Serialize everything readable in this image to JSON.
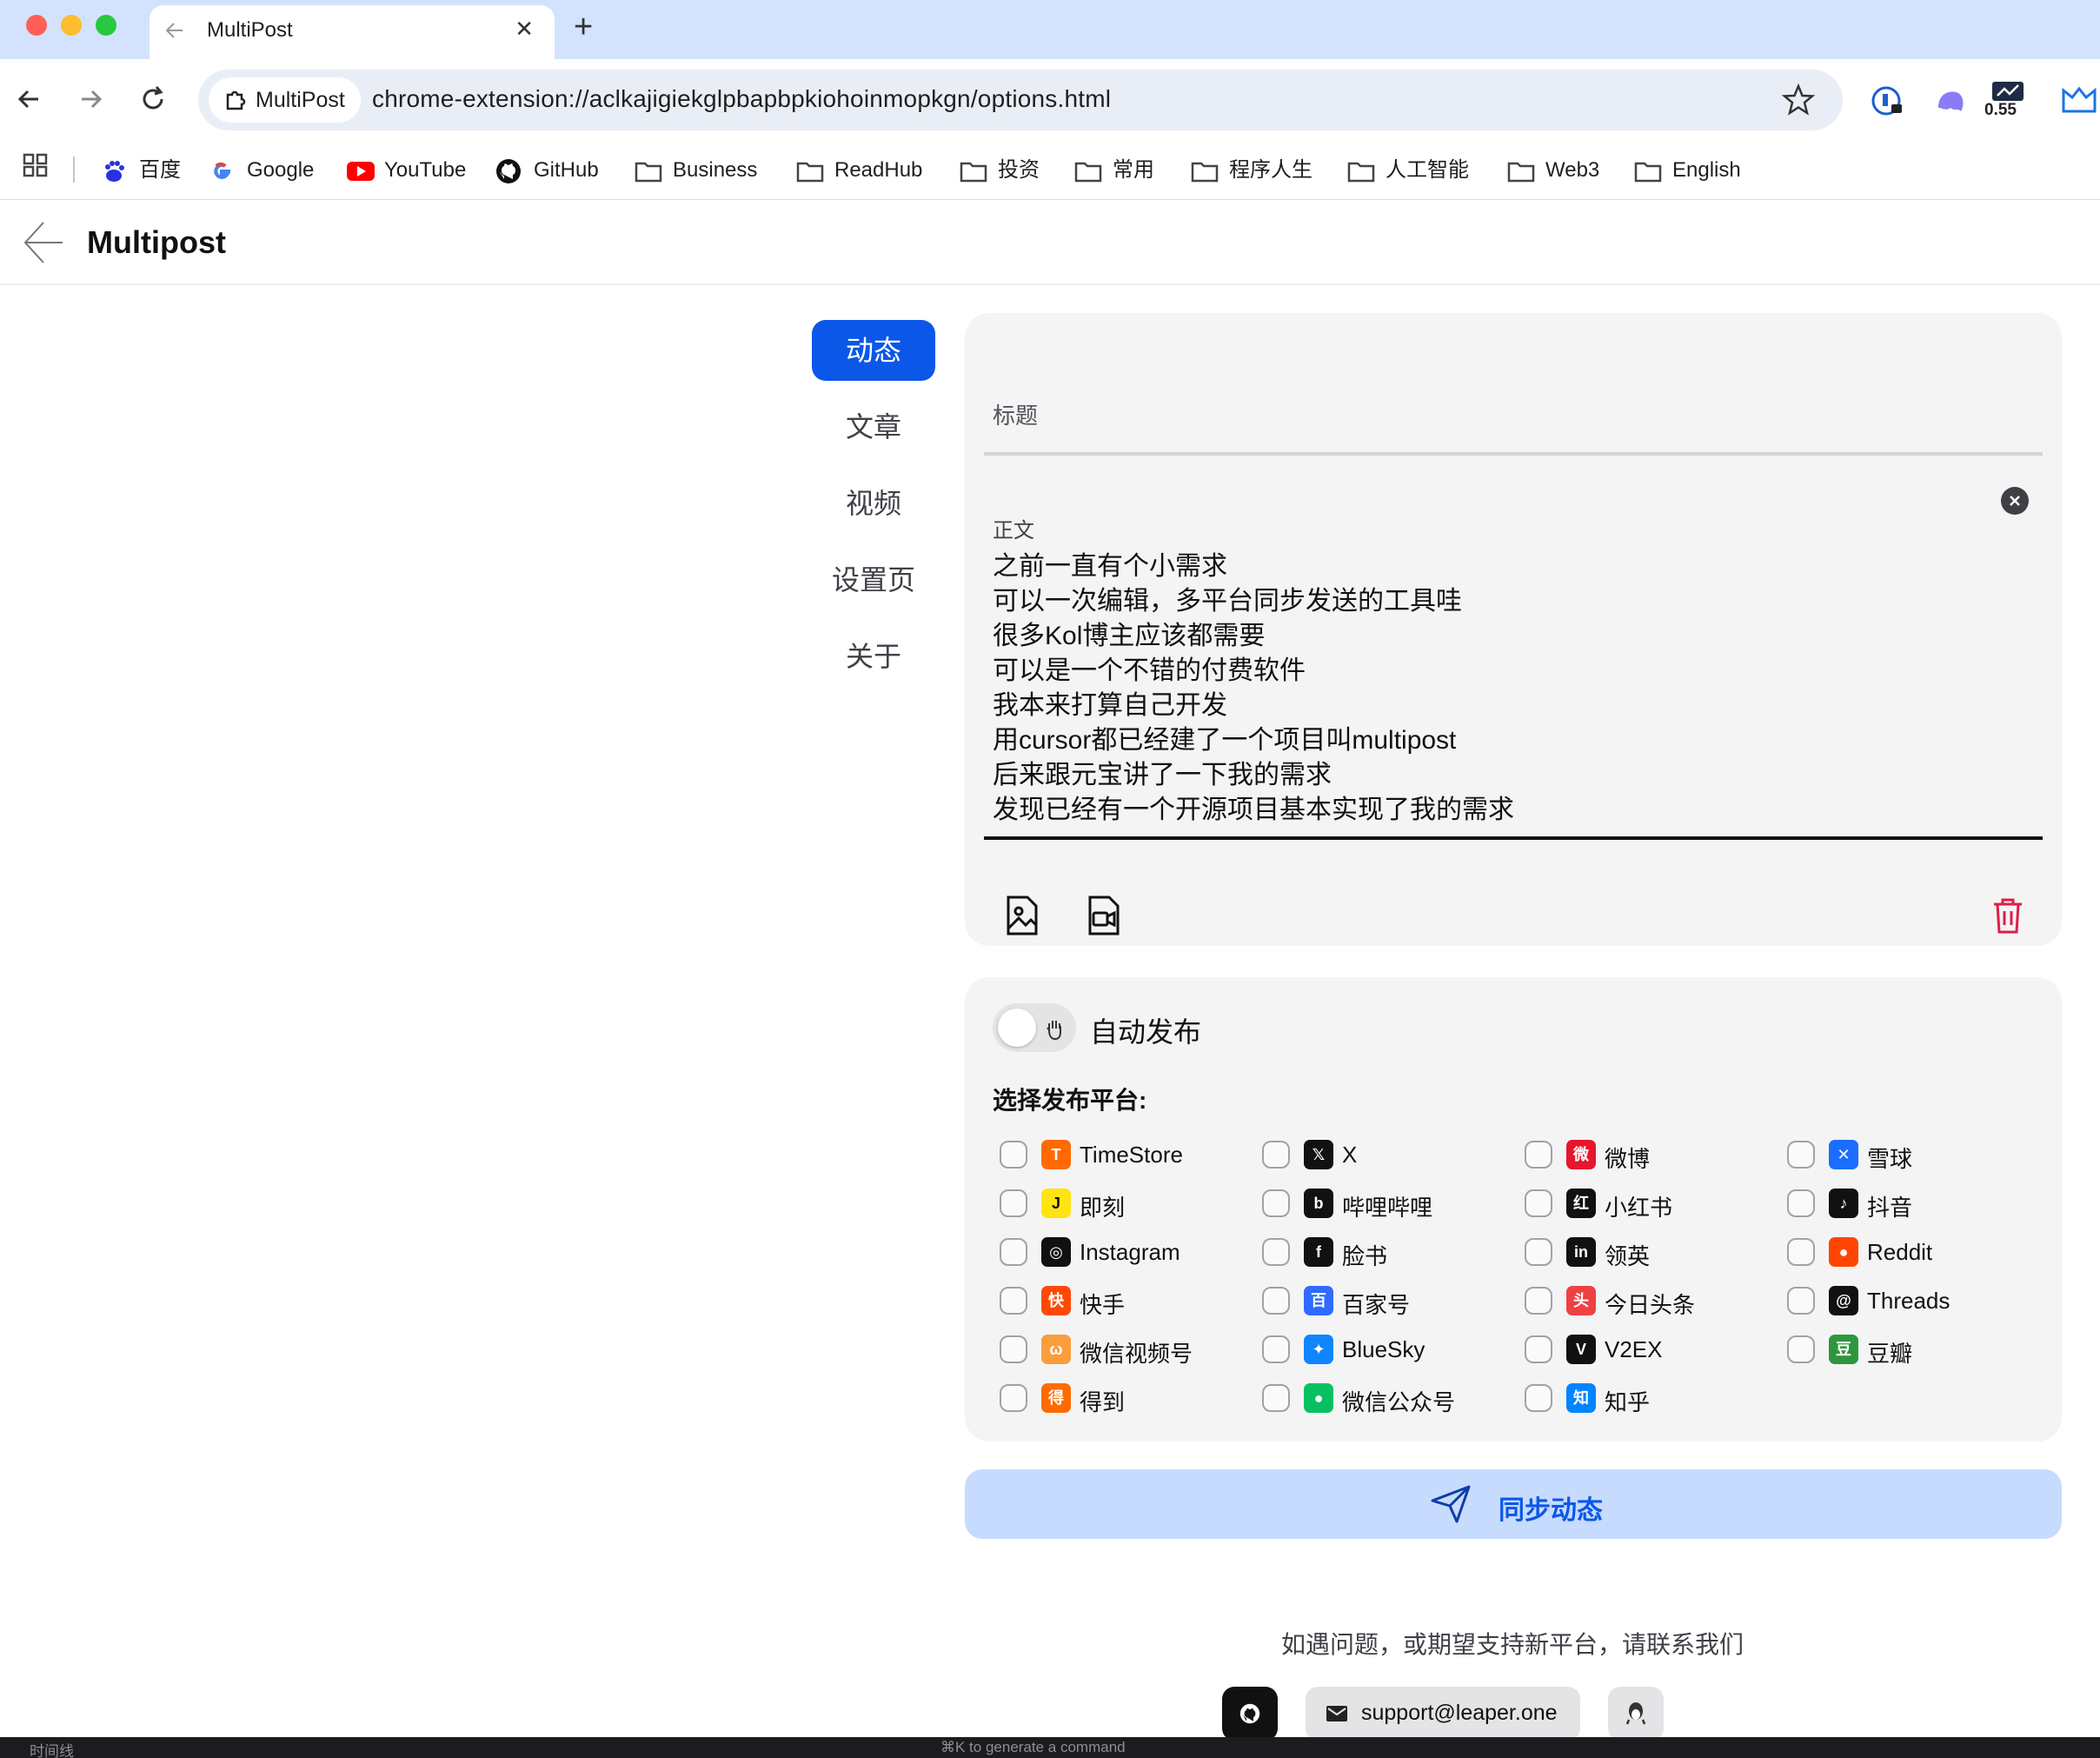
{
  "browser": {
    "tab_title": "MultiPost",
    "site_chip": "MultiPost",
    "url": "chrome-extension://aclkajigiekglpbapbpkiohoinmopkgn/options.html",
    "extension_badge": "0.55"
  },
  "bookmarks": [
    {
      "label": "百度",
      "icon": "baidu-icon"
    },
    {
      "label": "Google",
      "icon": "google-icon"
    },
    {
      "label": "YouTube",
      "icon": "youtube-icon"
    },
    {
      "label": "GitHub",
      "icon": "github-icon"
    },
    {
      "label": "Business",
      "icon": "folder-icon"
    },
    {
      "label": "ReadHub",
      "icon": "folder-icon"
    },
    {
      "label": "投资",
      "icon": "folder-icon"
    },
    {
      "label": "常用",
      "icon": "folder-icon"
    },
    {
      "label": "程序人生",
      "icon": "folder-icon"
    },
    {
      "label": "人工智能",
      "icon": "folder-icon"
    },
    {
      "label": "Web3",
      "icon": "folder-icon"
    },
    {
      "label": "English",
      "icon": "folder-icon"
    }
  ],
  "header": {
    "title": "Multipost"
  },
  "sidenav": {
    "items": [
      {
        "label": "动态",
        "active": true
      },
      {
        "label": "文章",
        "active": false
      },
      {
        "label": "视频",
        "active": false
      },
      {
        "label": "设置页",
        "active": false
      },
      {
        "label": "关于",
        "active": false
      }
    ]
  },
  "editor": {
    "title_placeholder": "标题",
    "body_label": "正文",
    "body_lines": [
      "之前一直有个小需求",
      "可以一次编辑，多平台同步发送的工具哇",
      "很多Kol博主应该都需要",
      "可以是一个不错的付费软件",
      "我本来打算自己开发",
      "用cursor都已经建了一个项目叫multipost",
      "后来跟元宝讲了一下我的需求",
      "发现已经有一个开源项目基本实现了我的需求"
    ]
  },
  "publish": {
    "auto_publish_label": "自动发布",
    "auto_publish_on": false,
    "platform_heading": "选择发布平台:",
    "platforms": [
      {
        "name": "TimeStore",
        "icon": "timestore-icon",
        "color": "#ff6a00",
        "glyph": "T"
      },
      {
        "name": "X",
        "icon": "x-icon",
        "color": "#111111",
        "glyph": "𝕏"
      },
      {
        "name": "微博",
        "icon": "weibo-icon",
        "color": "#e6162d",
        "glyph": "微"
      },
      {
        "name": "雪球",
        "icon": "xueqiu-icon",
        "color": "#1a6dff",
        "glyph": "✕"
      },
      {
        "name": "即刻",
        "icon": "jike-icon",
        "color": "#ffe411",
        "glyph": "J"
      },
      {
        "name": "哔哩哔哩",
        "icon": "bilibili-icon",
        "color": "#111111",
        "glyph": "b"
      },
      {
        "name": "小红书",
        "icon": "xiaohongshu-icon",
        "color": "#111111",
        "glyph": "红"
      },
      {
        "name": "抖音",
        "icon": "douyin-icon",
        "color": "#111111",
        "glyph": "♪"
      },
      {
        "name": "Instagram",
        "icon": "instagram-icon",
        "color": "#111111",
        "glyph": "◎"
      },
      {
        "name": "脸书",
        "icon": "facebook-icon",
        "color": "#111111",
        "glyph": "f"
      },
      {
        "name": "领英",
        "icon": "linkedin-icon",
        "color": "#111111",
        "glyph": "in"
      },
      {
        "name": "Reddit",
        "icon": "reddit-icon",
        "color": "#ff4500",
        "glyph": "●"
      },
      {
        "name": "快手",
        "icon": "kuaishou-icon",
        "color": "#ff4906",
        "glyph": "快"
      },
      {
        "name": "百家号",
        "icon": "baijiahao-icon",
        "color": "#2f6bff",
        "glyph": "百"
      },
      {
        "name": "今日头条",
        "icon": "toutiao-icon",
        "color": "#f04142",
        "glyph": "头"
      },
      {
        "name": "Threads",
        "icon": "threads-icon",
        "color": "#111111",
        "glyph": "@"
      },
      {
        "name": "微信视频号",
        "icon": "channels-icon",
        "color": "#fa9d3b",
        "glyph": "ω"
      },
      {
        "name": "BlueSky",
        "icon": "bluesky-icon",
        "color": "#1185fe",
        "glyph": "✦"
      },
      {
        "name": "V2EX",
        "icon": "v2ex-icon",
        "color": "#111111",
        "glyph": "V"
      },
      {
        "name": "豆瓣",
        "icon": "douban-icon",
        "color": "#2e963d",
        "glyph": "豆"
      },
      {
        "name": "得到",
        "icon": "dedao-icon",
        "color": "#ff6b00",
        "glyph": "得"
      },
      {
        "name": "微信公众号",
        "icon": "wechat-mp-icon",
        "color": "#07c160",
        "glyph": "●"
      },
      {
        "name": "知乎",
        "icon": "zhihu-icon",
        "color": "#0084ff",
        "glyph": "知"
      }
    ]
  },
  "sync_button": {
    "label": "同步动态"
  },
  "footer": {
    "text": "如遇问题，或期望支持新平台，请联系我们",
    "email": "support@leaper.one"
  },
  "bottom_bar": {
    "left": "时间线",
    "center": "⌘K to generate a command"
  }
}
